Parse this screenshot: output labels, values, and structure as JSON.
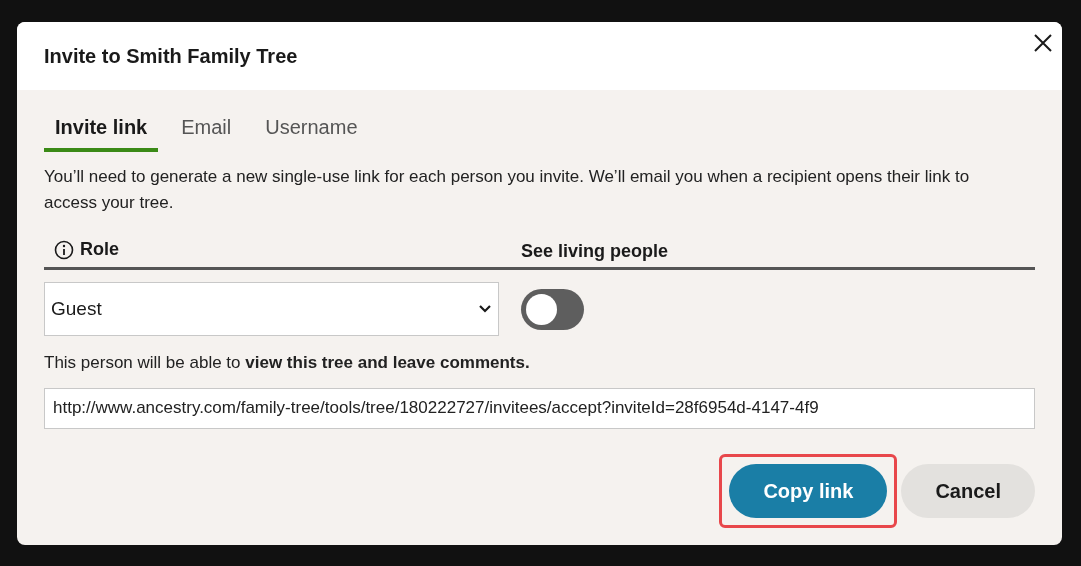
{
  "dialog": {
    "title": "Invite to Smith Family Tree",
    "tabs": [
      {
        "label": "Invite link",
        "selected": true
      },
      {
        "label": "Email",
        "selected": false
      },
      {
        "label": "Username",
        "selected": false
      }
    ],
    "description": "You’ll need to generate a new single-use link for each person you invite. We’ll email you when a recipient opens their link to access your tree.",
    "role": {
      "label": "Role",
      "value": "Guest"
    },
    "living": {
      "label": "See living people",
      "on": false
    },
    "permission": "This person will be able to **view this tree and leave comments.**",
    "link": "http://www.ancestry.com/family-tree/tools/tree/180222727/invitees/accept?inviteId=28f6954d-4147-4f9",
    "buttons": [
      {
        "label": "Copy link",
        "kind": "primary",
        "highlighted": true
      },
      {
        "label": "Cancel",
        "kind": "secondary",
        "highlighted": false
      }
    ]
  }
}
